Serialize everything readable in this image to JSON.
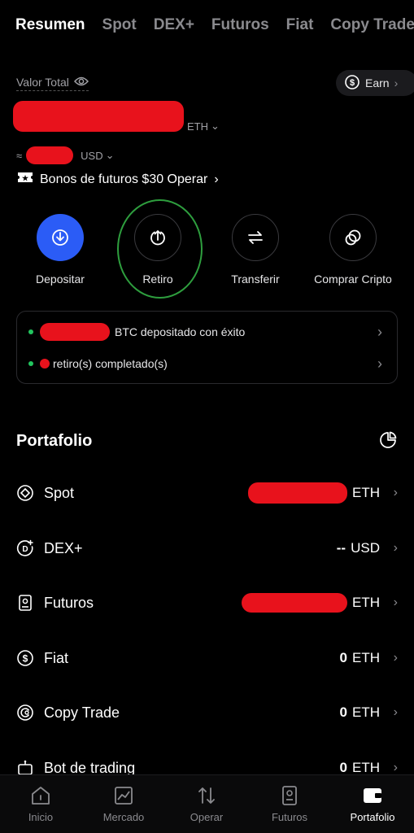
{
  "tabs": [
    "Resumen",
    "Spot",
    "DEX+",
    "Futuros",
    "Fiat",
    "Copy Trade"
  ],
  "valor_total_label": "Valor Total",
  "earn_label": "Earn",
  "balance": {
    "currency_main": "ETH",
    "approx_symbol": "≈",
    "currency_secondary": "USD"
  },
  "bonus_text": "Bonos de futuros $30 Operar",
  "actions": [
    {
      "label": "Depositar"
    },
    {
      "label": "Retiro"
    },
    {
      "label": "Transferir"
    },
    {
      "label": "Comprar Cripto"
    }
  ],
  "notifications": [
    {
      "text": "BTC depositado con éxito"
    },
    {
      "text": "retiro(s) completado(s)"
    }
  ],
  "portfolio_title": "Portafolio",
  "portfolio": [
    {
      "name": "Spot",
      "value": "",
      "unit": "ETH"
    },
    {
      "name": "DEX+",
      "value": "--",
      "unit": "USD"
    },
    {
      "name": "Futuros",
      "value": "",
      "unit": "ETH"
    },
    {
      "name": "Fiat",
      "value": "0",
      "unit": "ETH"
    },
    {
      "name": "Copy Trade",
      "value": "0",
      "unit": "ETH"
    },
    {
      "name": "Bot de trading",
      "value": "0",
      "unit": "ETH"
    }
  ],
  "bottom_nav": [
    "Inicio",
    "Mercado",
    "Operar",
    "Futuros",
    "Portafolio"
  ],
  "colors": {
    "accent_blue": "#2b5cf6",
    "success_green": "#22c55e",
    "redaction": "#e8121c"
  }
}
